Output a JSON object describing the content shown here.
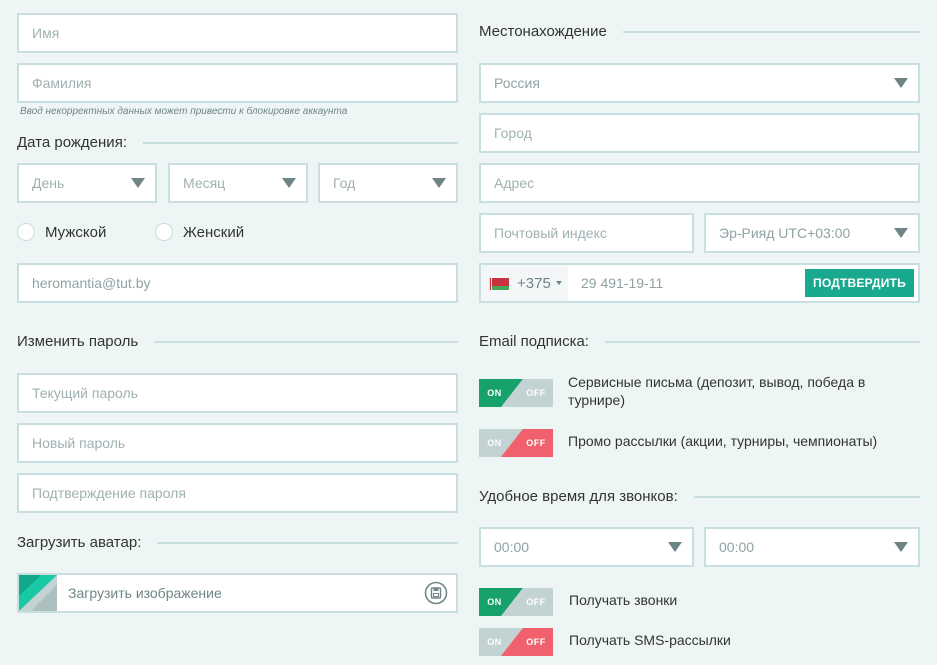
{
  "left": {
    "first_name_placeholder": "Имя",
    "last_name_placeholder": "Фамилия",
    "hint": "Ввод некорректных данных может привести к блокировке аккаунта",
    "birth_title": "Дата рождения:",
    "day": "День",
    "month": "Месяц",
    "year": "Год",
    "gender_male": "Мужской",
    "gender_female": "Женский",
    "email": "heromantia@tut.by",
    "password_title": "Изменить пароль",
    "current_password": "Текущий пароль",
    "new_password": "Новый пароль",
    "confirm_password": "Подтверждение пароля",
    "avatar_title": "Загрузить аватар:",
    "upload_label": "Загрузить изображение"
  },
  "right": {
    "location_title": "Местонахождение",
    "country": "Россия",
    "city": "Город",
    "address": "Адрес",
    "postal": "Почтовый индекс",
    "timezone": "Эр-Рияд UTC+03:00",
    "phone_code": "+375",
    "phone_number": "29 491-19-11",
    "confirm_button": "ПОДТВЕРДИТЬ",
    "email_sub_title": "Email подписка:",
    "toggle_on": "ON",
    "toggle_off": "OFF",
    "service_letters": "Сервисные письма (депозит, вывод, победа в турнире)",
    "promo": "Промо рассылки (акции, турниры, чемпионаты)",
    "call_time_title": "Удобное время для звонков:",
    "time_from": "00:00",
    "time_to": "00:00",
    "get_calls": "Получать звонки",
    "get_sms": "Получать SMS-рассылки"
  },
  "colors": {
    "on": "#17a26c",
    "off": "#f0616d",
    "accent": "#19a98f",
    "border": "#c9dede"
  }
}
